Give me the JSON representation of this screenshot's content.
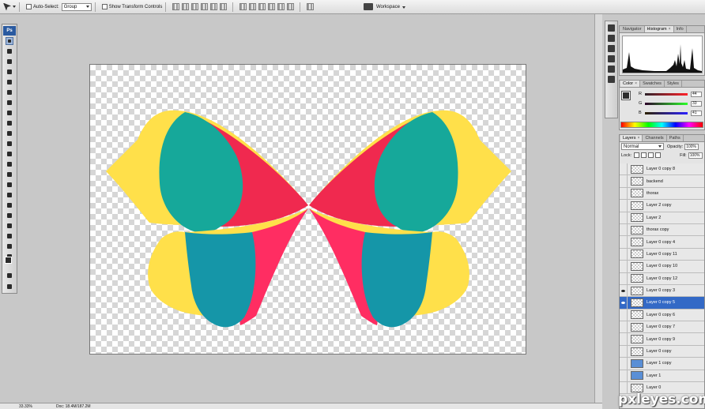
{
  "options_bar": {
    "auto_select_label": "Auto-Select:",
    "auto_select_value": "Group",
    "transform_label": "Show Transform Controls",
    "workspace_label": "Workspace"
  },
  "tools": {
    "logo": "Ps"
  },
  "navigator_panel": {
    "tabs": [
      "Navigator",
      "Histogram",
      "Info"
    ]
  },
  "color_panel": {
    "tabs": [
      "Color",
      "Swatches",
      "Styles"
    ],
    "r_label": "R",
    "g_label": "G",
    "b_label": "B",
    "r": "44",
    "g": "33",
    "b": "41",
    "fg_color": "#2c2c2c"
  },
  "layers_panel": {
    "tabs": [
      "Layers",
      "Channels",
      "Paths"
    ],
    "blend_mode": "Normal",
    "opacity_label": "Opacity:",
    "opacity": "100%",
    "lock_label": "Lock:",
    "fill_label": "Fill:",
    "fill": "100%",
    "layers": [
      {
        "name": "Layer 0 copy 8",
        "visible": false,
        "thumb": "bf"
      },
      {
        "name": "backend",
        "visible": false,
        "thumb": "empty"
      },
      {
        "name": "thorax",
        "visible": false,
        "thumb": "empty"
      },
      {
        "name": "Layer 2 copy",
        "visible": false,
        "thumb": "empty"
      },
      {
        "name": "Layer 2",
        "visible": false,
        "thumb": "empty"
      },
      {
        "name": "thorax copy",
        "visible": false,
        "thumb": "empty"
      },
      {
        "name": "Layer 0 copy 4",
        "visible": false,
        "thumb": "bf"
      },
      {
        "name": "Layer 0 copy 11",
        "visible": false,
        "thumb": "bf"
      },
      {
        "name": "Layer 0 copy 10",
        "visible": false,
        "thumb": "bf"
      },
      {
        "name": "Layer 0 copy 12",
        "visible": false,
        "thumb": "bf"
      },
      {
        "name": "Layer 0 copy 3",
        "visible": true,
        "thumb": "bf"
      },
      {
        "name": "Layer 0 copy 5",
        "visible": true,
        "thumb": "bf",
        "active": true
      },
      {
        "name": "Layer 0 copy 6",
        "visible": false,
        "thumb": "bf"
      },
      {
        "name": "Layer 0 copy 7",
        "visible": false,
        "thumb": "bf"
      },
      {
        "name": "Layer 0 copy 9",
        "visible": false,
        "thumb": "bf"
      },
      {
        "name": "Layer 0 copy",
        "visible": false,
        "thumb": "bf"
      },
      {
        "name": "Layer 1 copy",
        "visible": false,
        "thumb": "blue"
      },
      {
        "name": "Layer 1",
        "visible": false,
        "thumb": "blue"
      },
      {
        "name": "Layer 0",
        "visible": false,
        "thumb": "bf"
      }
    ]
  },
  "status_bar": {
    "zoom": "33.33%",
    "doc_info": "Doc: 18.4M/187.2M"
  },
  "watermark": "pxleyes.com",
  "colors": {
    "yellow": "#ffe04a",
    "teal": "#16a89a",
    "red": "#f0294f",
    "blue_teal": "#1596a8",
    "pink": "#ff2d62",
    "selection": "#3369c6"
  }
}
